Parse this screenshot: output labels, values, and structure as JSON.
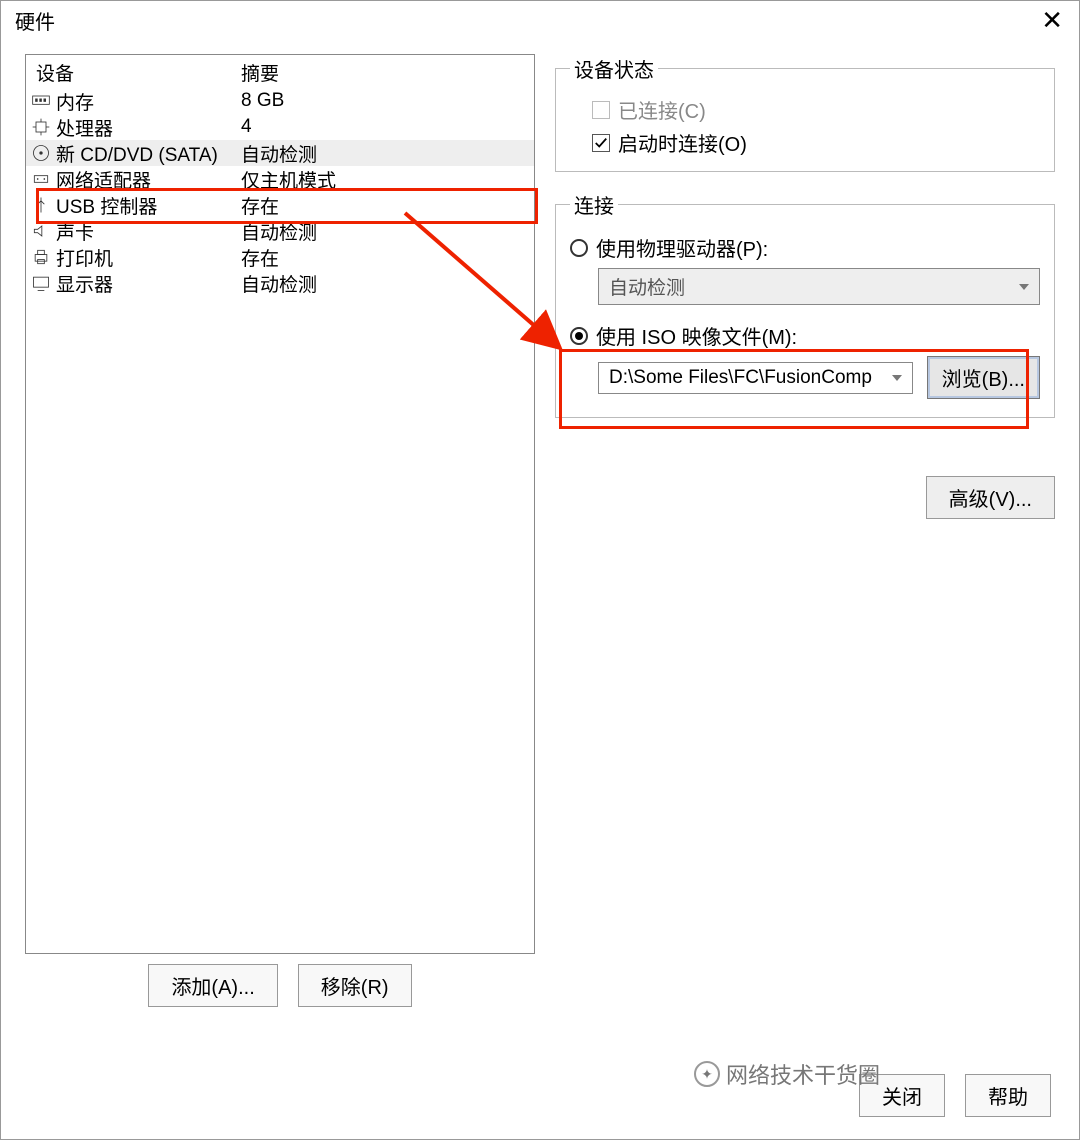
{
  "window": {
    "title": "硬件"
  },
  "columns": {
    "device": "设备",
    "summary": "摘要"
  },
  "devices": [
    {
      "name": "内存",
      "summary": "8 GB"
    },
    {
      "name": "处理器",
      "summary": "4"
    },
    {
      "name": "新 CD/DVD (SATA)",
      "summary": "自动检测",
      "selected": true
    },
    {
      "name": "网络适配器",
      "summary": "仅主机模式"
    },
    {
      "name": "USB 控制器",
      "summary": "存在"
    },
    {
      "name": "声卡",
      "summary": "自动检测"
    },
    {
      "name": "打印机",
      "summary": "存在"
    },
    {
      "name": "显示器",
      "summary": "自动检测"
    }
  ],
  "buttons": {
    "add": "添加(A)...",
    "remove": "移除(R)",
    "close": "关闭",
    "help": "帮助",
    "browse": "浏览(B)...",
    "advanced": "高级(V)..."
  },
  "status": {
    "legend": "设备状态",
    "connected": "已连接(C)",
    "connect_on_power": "启动时连接(O)"
  },
  "connection": {
    "legend": "连接",
    "physical": "使用物理驱动器(P):",
    "physical_value": "自动检测",
    "iso": "使用 ISO 映像文件(M):",
    "iso_value": "D:\\Some Files\\FC\\FusionComp"
  },
  "watermark": "网络技术干货圈"
}
